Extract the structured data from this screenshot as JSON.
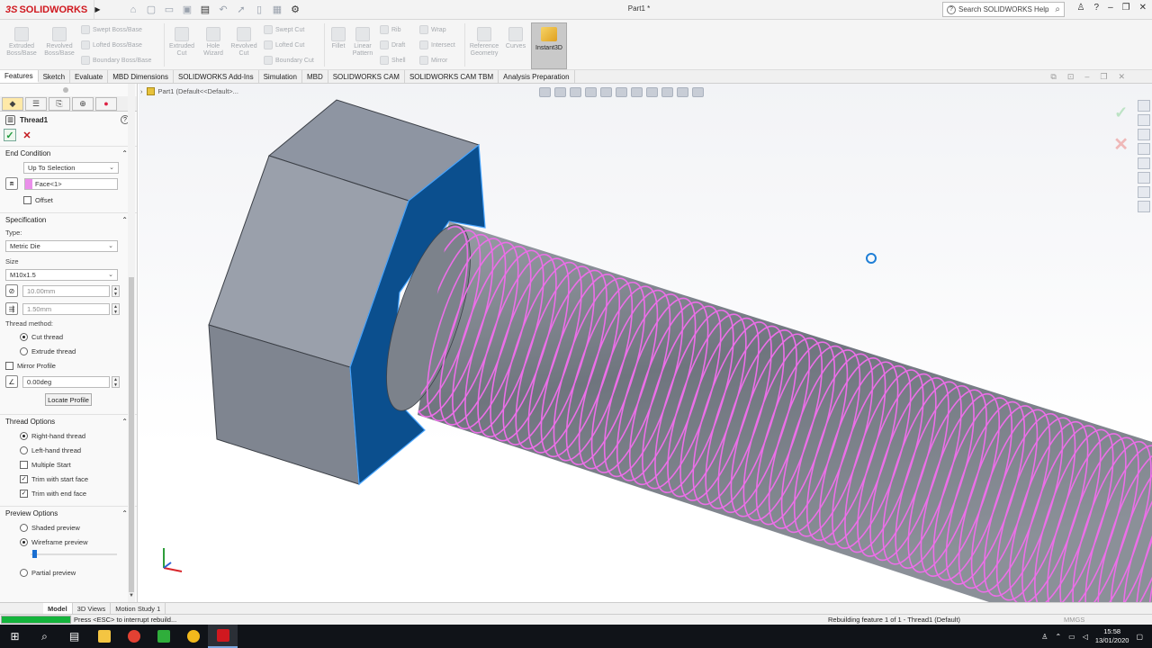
{
  "app": {
    "logo_prefix": "3S",
    "logo_name": "SOLIDWORKS",
    "document_title": "Part1 *",
    "help_search_placeholder": "Search SOLIDWORKS Help"
  },
  "ribbon": {
    "buttons": [
      {
        "key": "extruded-boss",
        "label1": "Extruded",
        "label2": "Boss/Base"
      },
      {
        "key": "revolved-boss",
        "label1": "Revolved",
        "label2": "Boss/Base"
      },
      {
        "key": "extruded-cut",
        "label1": "Extruded",
        "label2": "Cut"
      },
      {
        "key": "hole-wizard",
        "label1": "Hole",
        "label2": "Wizard"
      },
      {
        "key": "revolved-cut",
        "label1": "Revolved",
        "label2": "Cut"
      },
      {
        "key": "fillet",
        "label1": "Fillet",
        "label2": ""
      },
      {
        "key": "linear-pattern",
        "label1": "Linear",
        "label2": "Pattern"
      },
      {
        "key": "reference-geometry",
        "label1": "Reference",
        "label2": "Geometry"
      },
      {
        "key": "curves",
        "label1": "Curves",
        "label2": ""
      }
    ],
    "small_buttons": {
      "swept_boss": "Swept Boss/Base",
      "lofted_boss": "Lofted Boss/Base",
      "boundary_boss": "Boundary Boss/Base",
      "swept_cut": "Swept Cut",
      "lofted_cut": "Lofted Cut",
      "boundary_cut": "Boundary Cut",
      "rib": "Rib",
      "draft": "Draft",
      "shell": "Shell",
      "wrap": "Wrap",
      "intersect": "Intersect",
      "mirror": "Mirror"
    },
    "instant3d": "Instant3D"
  },
  "tabs": [
    "Features",
    "Sketch",
    "Evaluate",
    "MBD Dimensions",
    "SOLIDWORKS Add-Ins",
    "Simulation",
    "MBD",
    "SOLIDWORKS CAM",
    "SOLIDWORKS CAM TBM",
    "Analysis Preparation"
  ],
  "feature": {
    "title": "Thread1",
    "end_condition": {
      "header": "End Condition",
      "type_value": "Up To Selection",
      "face_value": "Face<1>",
      "offset_label": "Offset"
    },
    "specification": {
      "header": "Specification",
      "type_label": "Type:",
      "type_value": "Metric Die",
      "size_label": "Size",
      "size_value": "M10x1.5",
      "diameter_value": "10.00mm",
      "pitch_value": "1.50mm",
      "method_label": "Thread method:",
      "cut_thread": "Cut thread",
      "extrude_thread": "Extrude thread",
      "mirror_profile": "Mirror Profile",
      "angle_value": "0.00deg",
      "locate_profile": "Locate Profile"
    },
    "thread_options": {
      "header": "Thread Options",
      "right_hand": "Right-hand thread",
      "left_hand": "Left-hand thread",
      "multiple_start": "Multiple Start",
      "trim_start": "Trim with start face",
      "trim_end": "Trim with end face"
    },
    "preview_options": {
      "header": "Preview Options",
      "shaded": "Shaded preview",
      "wireframe": "Wireframe preview",
      "partial": "Partial preview"
    }
  },
  "graphics": {
    "breadcrumb": "Part1  (Default<<Default>...",
    "thread_color": "#ec6ee8",
    "selected_face_color": "#0b4f8e",
    "hex_face_color": "#8f96a3",
    "bolt_color": "#7b818b"
  },
  "bottom_tabs": [
    "Model",
    "3D Views",
    "Motion Study 1"
  ],
  "status": {
    "progress_fraction": 1.0,
    "message": "Press <ESC> to interrupt rebuild...",
    "rebuild_message": "Rebuilding feature 1 of 1 - Thread1 (Default)",
    "units": "MMGS"
  },
  "taskbar": {
    "time": "15:58",
    "date": "13/01/2020"
  }
}
